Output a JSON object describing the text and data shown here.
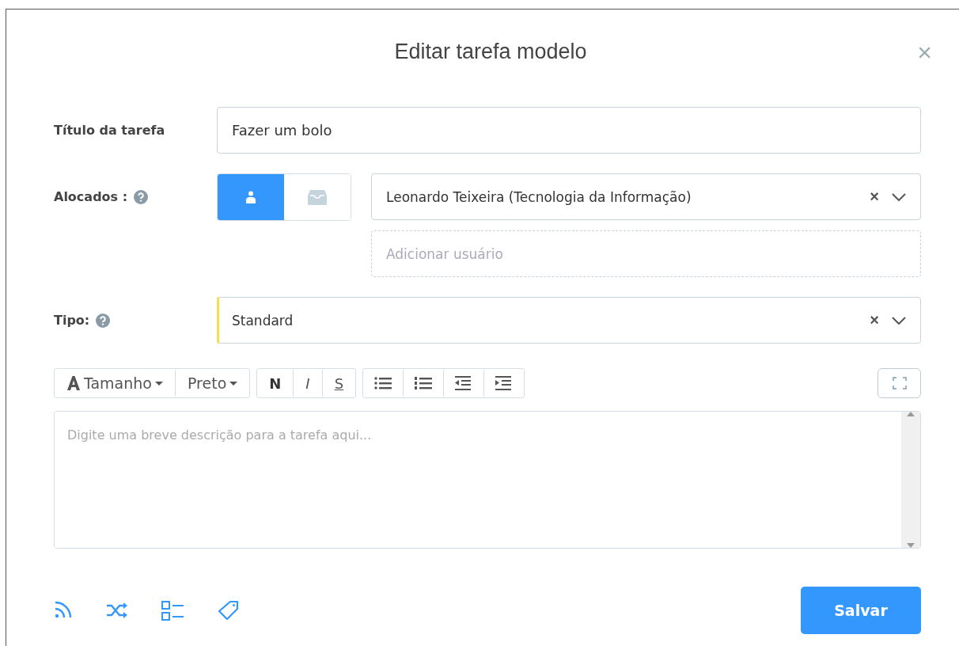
{
  "dialog": {
    "title": "Editar tarefa modelo",
    "close": "×"
  },
  "task_title": {
    "label": "Título da tarefa",
    "value": "Fazer um bolo"
  },
  "assignees": {
    "label": "Alocados :",
    "help": true,
    "modes": [
      {
        "kind": "user",
        "selected": true
      },
      {
        "kind": "inbox",
        "selected": false
      }
    ],
    "selected_value": "Leonardo Teixeira (Tecnologia da Informação)",
    "clear": "×",
    "add_placeholder": "Adicionar usuário"
  },
  "type": {
    "label": "Tipo:",
    "help": true,
    "value": "Standard",
    "color": "#f5e04a",
    "clear": "×"
  },
  "toolbar": [
    [
      {
        "kind": "size",
        "label": "Tamanho"
      },
      {
        "kind": "color",
        "label": "Preto"
      }
    ],
    [
      {
        "kind": "bold",
        "label": "N"
      },
      {
        "kind": "italic",
        "label": "I"
      },
      {
        "kind": "strike",
        "label": "S"
      }
    ],
    [
      {
        "kind": "bullets"
      },
      {
        "kind": "numbers"
      },
      {
        "kind": "outdent"
      },
      {
        "kind": "indent"
      }
    ]
  ],
  "description": {
    "placeholder": "Digite uma breve descrição para a tarefa aqui..."
  },
  "footer_icons": [
    {
      "kind": "feed"
    },
    {
      "kind": "shuffle"
    },
    {
      "kind": "checklist"
    },
    {
      "kind": "tag"
    }
  ],
  "save_button": "Salvar"
}
